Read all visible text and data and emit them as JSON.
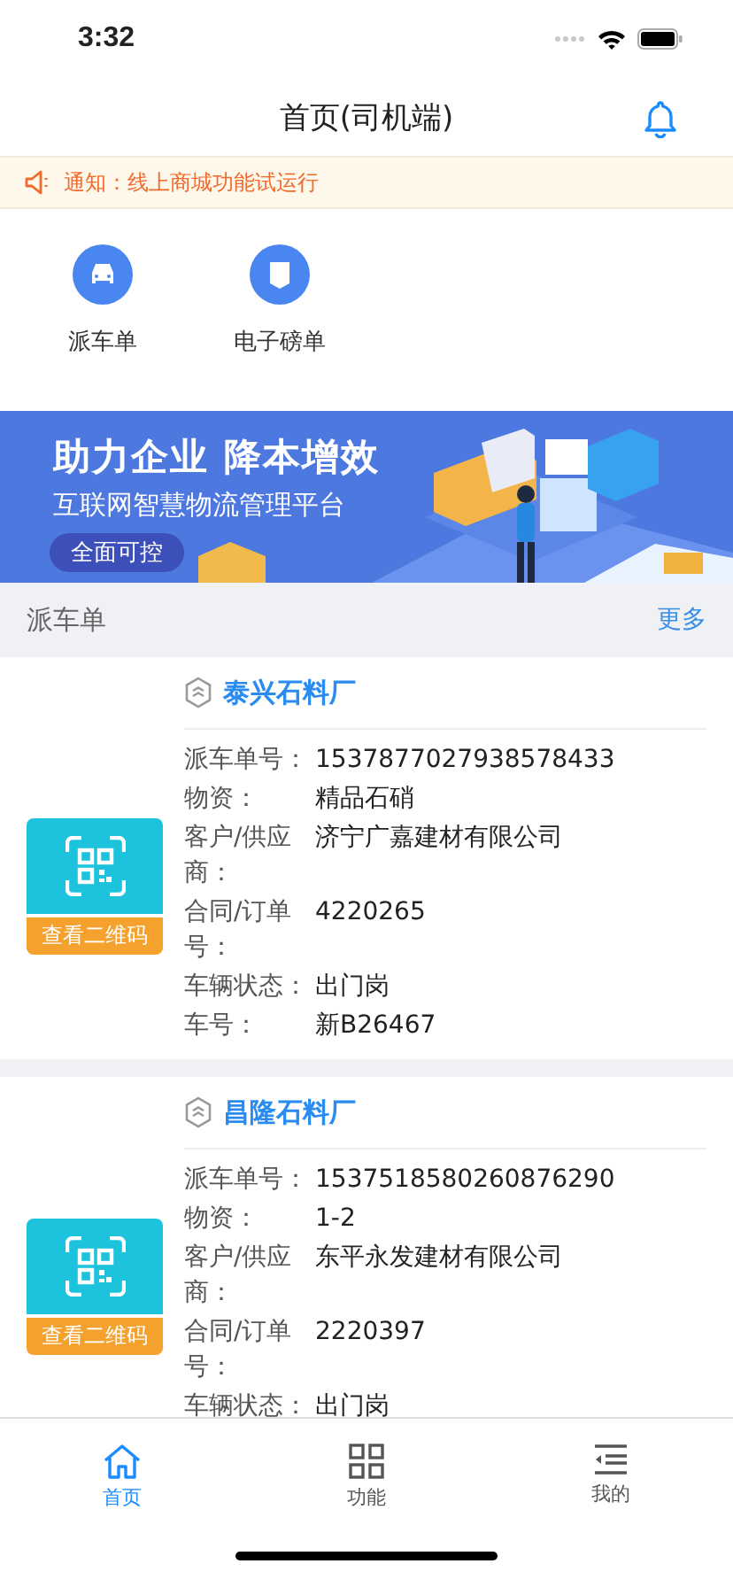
{
  "status_bar": {
    "time": "3:32"
  },
  "header": {
    "title": "首页(司机端)"
  },
  "notice": {
    "text": "通知：线上商城功能试运行"
  },
  "shortcuts": [
    {
      "label": "派车单",
      "kind": "car"
    },
    {
      "label": "电子磅单",
      "kind": "ticket"
    }
  ],
  "banner": {
    "headline": "助力企业 降本增效",
    "subtitle": "互联网智慧物流管理平台",
    "badge": "全面可控"
  },
  "section": {
    "title": "派车单",
    "more": "更多"
  },
  "orders": [
    {
      "company": "泰兴石料厂",
      "qr_label": "查看二维码",
      "fields": [
        {
          "label": "派车单号：",
          "value": "1537877027938578433"
        },
        {
          "label": "物资：",
          "value": "精品石硝"
        },
        {
          "label": "客户/供应商：",
          "value": "济宁广嘉建材有限公司"
        },
        {
          "label": "合同/订单号：",
          "value": "4220265"
        },
        {
          "label": "车辆状态：",
          "value": "出门岗"
        },
        {
          "label": "车号：",
          "value": "新B26467"
        }
      ]
    },
    {
      "company": "昌隆石料厂",
      "qr_label": "查看二维码",
      "fields": [
        {
          "label": "派车单号：",
          "value": "1537518580260876290"
        },
        {
          "label": "物资：",
          "value": "1-2"
        },
        {
          "label": "客户/供应商：",
          "value": "东平永发建材有限公司"
        },
        {
          "label": "合同/订单号：",
          "value": "2220397"
        },
        {
          "label": "车辆状态：",
          "value": "出门岗"
        }
      ]
    }
  ],
  "tabs": [
    {
      "label": "首页",
      "kind": "home",
      "selected": true
    },
    {
      "label": "功能",
      "kind": "grid",
      "selected": false
    },
    {
      "label": "我的",
      "kind": "list",
      "selected": false
    }
  ]
}
